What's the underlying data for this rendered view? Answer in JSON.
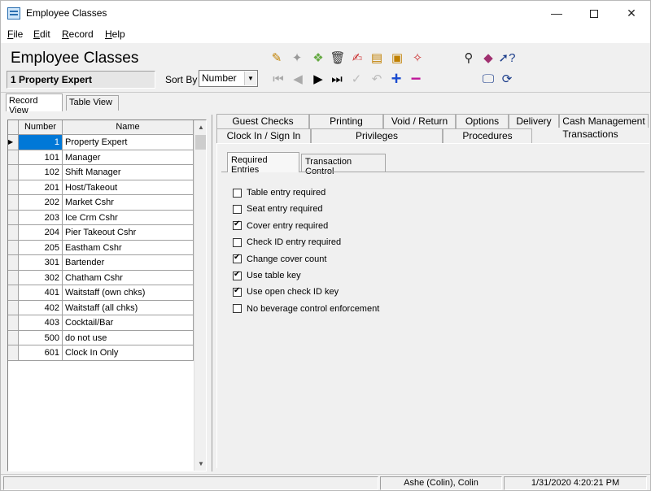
{
  "window": {
    "title": "Employee Classes"
  },
  "menu": [
    "File",
    "Edit",
    "Record",
    "Help"
  ],
  "header": {
    "title": "Employee Classes",
    "record": "1 Property Expert",
    "sort_by_label": "Sort By",
    "sort_by_value": "Number"
  },
  "toolbar_icons": [
    "new-record-icon",
    "add-icon",
    "copy-icon",
    "delete-icon",
    "edit-icon",
    "print-icon",
    "import-icon",
    "wizard-icon",
    "find-icon",
    "book-icon",
    "help-cursor-icon",
    "first-icon",
    "prev-icon",
    "next-icon",
    "last-icon",
    "check-icon",
    "undo-icon",
    "add-plus-icon",
    "remove-minus-icon",
    "computer-icon",
    "refresh-icon"
  ],
  "view_tabs": [
    "Record View",
    "Table View"
  ],
  "grid": {
    "columns": [
      "Number",
      "Name"
    ],
    "rows": [
      {
        "number": "1",
        "name": "Property Expert"
      },
      {
        "number": "101",
        "name": "Manager"
      },
      {
        "number": "102",
        "name": "Shift Manager"
      },
      {
        "number": "201",
        "name": "Host/Takeout"
      },
      {
        "number": "202",
        "name": "Market Cshr"
      },
      {
        "number": "203",
        "name": "Ice Crm Cshr"
      },
      {
        "number": "204",
        "name": "Pier Takeout Cshr"
      },
      {
        "number": "205",
        "name": "Eastham Cshr"
      },
      {
        "number": "301",
        "name": "Bartender"
      },
      {
        "number": "302",
        "name": "Chatham Cshr"
      },
      {
        "number": "401",
        "name": "Waitstaff (own chks)"
      },
      {
        "number": "402",
        "name": "Waitstaff (all chks)"
      },
      {
        "number": "403",
        "name": "Cocktail/Bar"
      },
      {
        "number": "500",
        "name": "do not use"
      },
      {
        "number": "601",
        "name": "Clock In Only"
      }
    ]
  },
  "tabs_row1": [
    "Guest Checks",
    "Printing",
    "Void / Return",
    "Options",
    "Delivery",
    "Cash Management"
  ],
  "tabs_row2": [
    "Clock In / Sign In",
    "Privileges",
    "Procedures",
    "Transactions"
  ],
  "subtabs": [
    "Required Entries",
    "Transaction Control"
  ],
  "options": [
    {
      "label": "Table entry required",
      "checked": false
    },
    {
      "label": "Seat entry required",
      "checked": false
    },
    {
      "label": "Cover entry required",
      "checked": true
    },
    {
      "label": "Check ID entry required",
      "checked": false
    },
    {
      "label": "Change cover count",
      "checked": true
    },
    {
      "label": "Use table key",
      "checked": true
    },
    {
      "label": "Use open check ID key",
      "checked": true
    },
    {
      "label": "No beverage control enforcement",
      "checked": false
    }
  ],
  "status": {
    "user": "Ashe (Colin), Colin",
    "datetime": "1/31/2020 4:20:21 PM"
  }
}
